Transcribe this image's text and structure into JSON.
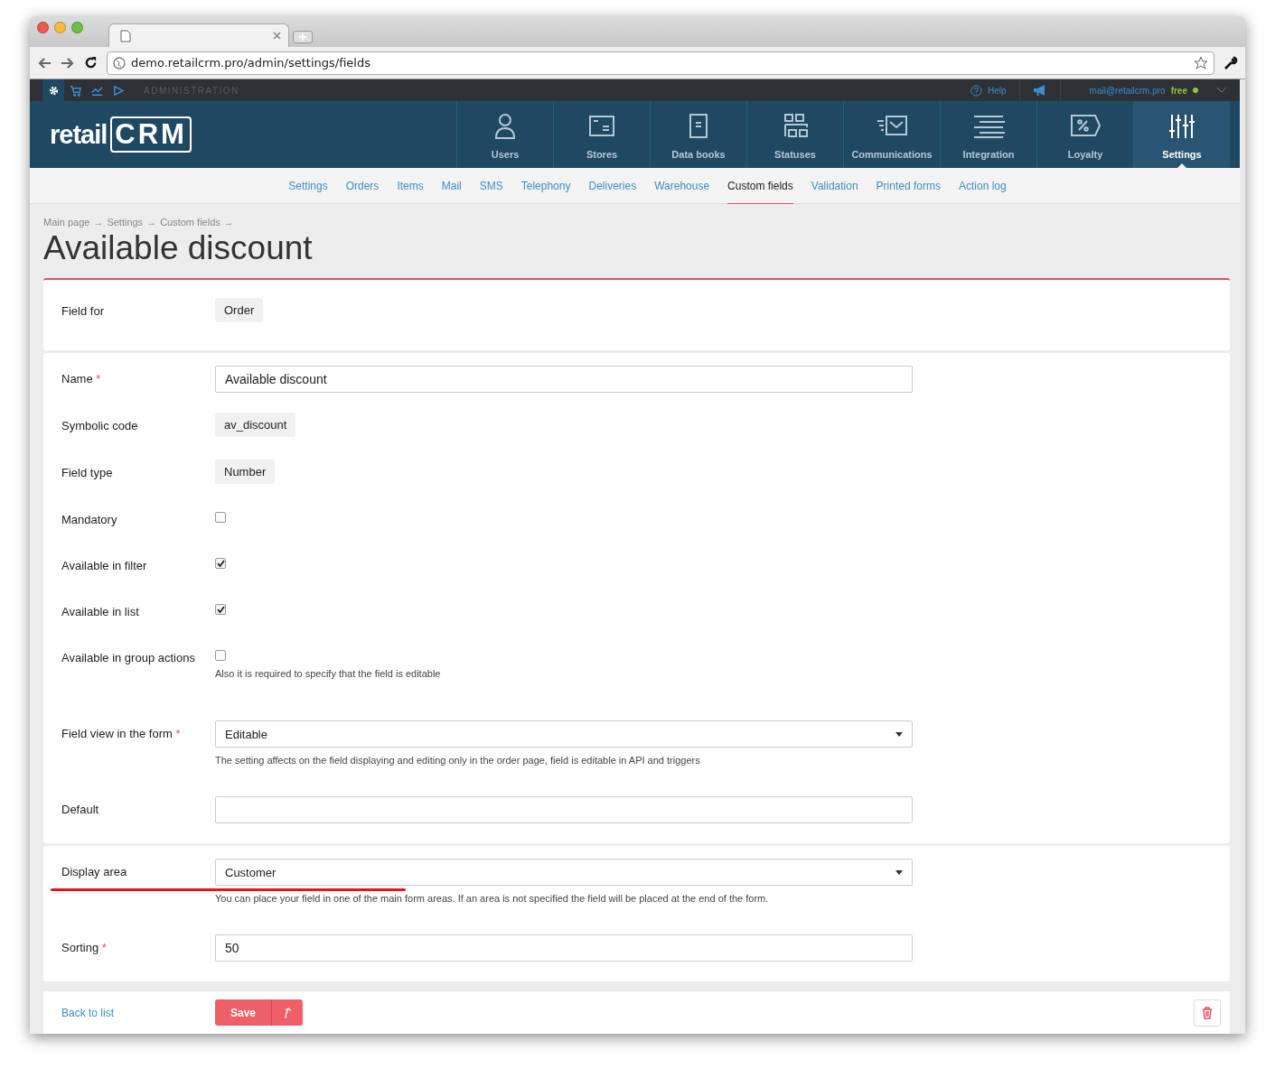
{
  "browser": {
    "url": "demo.retailcrm.pro/admin/settings/fields"
  },
  "admin_bar": {
    "tools": [
      {
        "kind": "gear",
        "selected": true
      },
      {
        "kind": "cart",
        "selected": false
      },
      {
        "kind": "chart",
        "selected": false
      },
      {
        "kind": "play",
        "selected": false
      }
    ],
    "label": "ADMINISTRATION",
    "help": "Help",
    "user": "mail@retailcrm.pro",
    "plan": "free"
  },
  "logo": {
    "word": "retail",
    "mark": "CRM"
  },
  "nav": [
    {
      "label": "Users",
      "kind": "users",
      "selected": false
    },
    {
      "label": "Stores",
      "kind": "stores",
      "selected": false
    },
    {
      "label": "Data books",
      "kind": "books",
      "selected": false
    },
    {
      "label": "Statuses",
      "kind": "statuses",
      "selected": false
    },
    {
      "label": "Communications",
      "kind": "mail",
      "selected": false
    },
    {
      "label": "Integration",
      "kind": "lines",
      "selected": false
    },
    {
      "label": "Loyalty",
      "kind": "percent",
      "selected": false
    },
    {
      "label": "Settings",
      "kind": "sliders",
      "selected": true
    }
  ],
  "subnav": [
    {
      "label": "Settings",
      "selected": false
    },
    {
      "label": "Orders",
      "selected": false
    },
    {
      "label": "Items",
      "selected": false
    },
    {
      "label": "Mail",
      "selected": false
    },
    {
      "label": "SMS",
      "selected": false
    },
    {
      "label": "Telephony",
      "selected": false
    },
    {
      "label": "Deliveries",
      "selected": false
    },
    {
      "label": "Warehouse",
      "selected": false
    },
    {
      "label": "Custom fields",
      "selected": true
    },
    {
      "label": "Validation",
      "selected": false
    },
    {
      "label": "Printed forms",
      "selected": false
    },
    {
      "label": "Action log",
      "selected": false
    }
  ],
  "breadcrumb": {
    "items": [
      "Main page",
      "Settings",
      "Custom fields"
    ],
    "separator": "→"
  },
  "title": "Available discount",
  "required_mark": "*",
  "sections": [
    {
      "rows": [
        {
          "kind": "tag",
          "label": "Field for",
          "required": false,
          "value": "Order"
        }
      ]
    },
    {
      "rows": [
        {
          "kind": "input",
          "label": "Name",
          "required": true,
          "value": "Available discount"
        },
        {
          "kind": "tag",
          "label": "Symbolic code",
          "required": false,
          "value": "av_discount"
        },
        {
          "kind": "tag",
          "label": "Field type",
          "required": false,
          "value": "Number"
        },
        {
          "kind": "checkbox",
          "label": "Mandatory",
          "required": false,
          "checked": false
        },
        {
          "kind": "checkbox",
          "label": "Available in filter",
          "required": false,
          "checked": true
        },
        {
          "kind": "checkbox",
          "label": "Available in list",
          "required": false,
          "checked": true
        },
        {
          "kind": "checkbox",
          "label": "Available in group actions",
          "required": false,
          "checked": false,
          "hint": "Also it is required to specify that the field is editable"
        },
        {
          "kind": "select",
          "label": "Field view in the form",
          "required": true,
          "value": "Editable",
          "hint": "The setting affects on the field displaying and editing only in the order page, field is editable in API and triggers"
        },
        {
          "kind": "input",
          "label": "Default",
          "required": false
        }
      ]
    },
    {
      "rows": [
        {
          "kind": "select",
          "label": "Display area",
          "required": false,
          "value": "Customer",
          "underlined": true,
          "hint": "You can place your field in one of the main form areas. If an area is not specified the field will be placed at the end of the form."
        },
        {
          "kind": "input",
          "label": "Sorting",
          "required": true,
          "value": "50"
        }
      ]
    }
  ],
  "footer": {
    "back": "Back to list",
    "save": "Save"
  }
}
